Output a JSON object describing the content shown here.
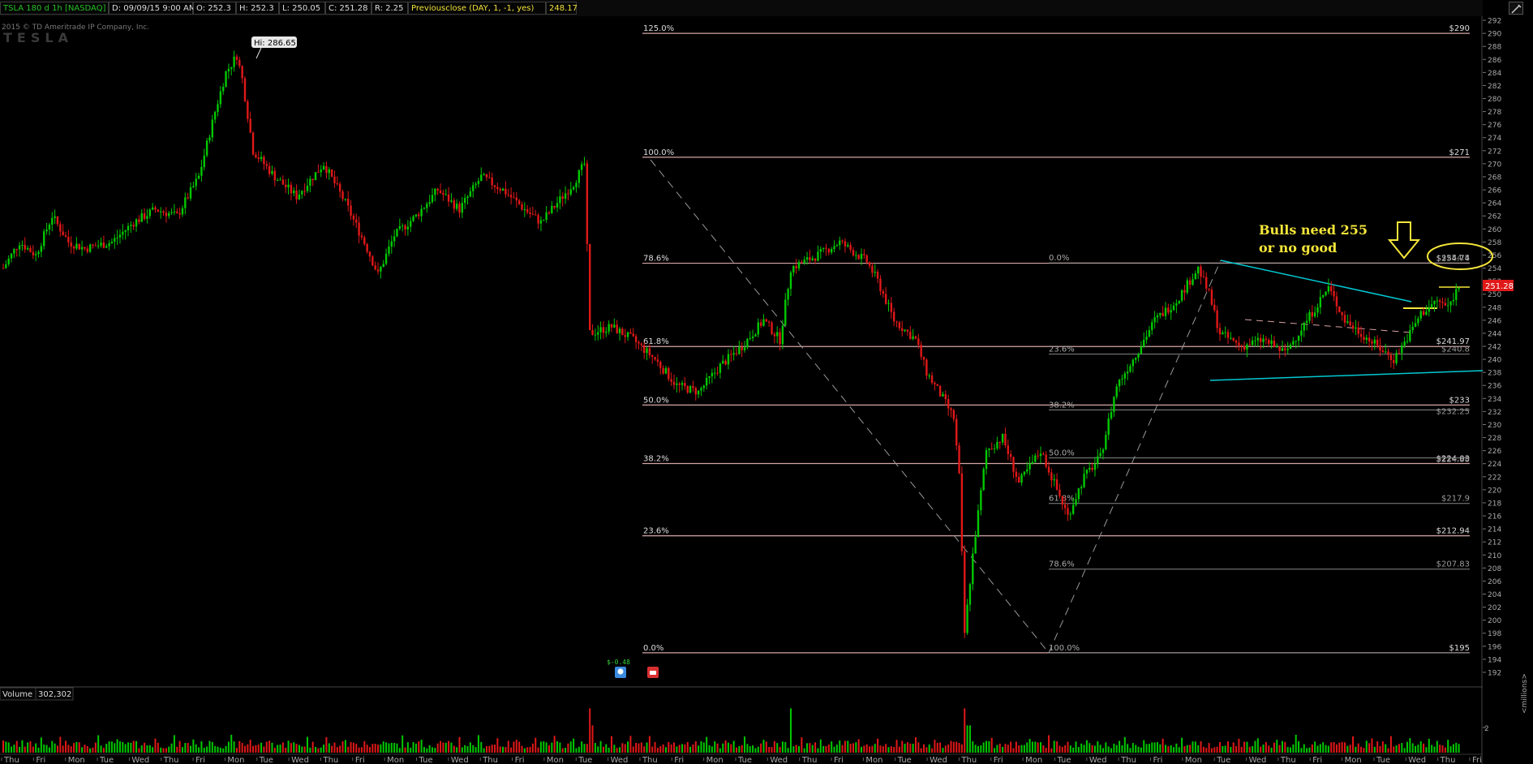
{
  "header": {
    "symbol": "TSLA 180 d 1h [NASDAQ]",
    "date": "D: 09/09/15 9:00 AM",
    "open": "O: 252.3",
    "high": "H: 252.3",
    "low": "L: 250.05",
    "close": "C: 251.28",
    "range": "R: 2.25",
    "study": "Previousclose (DAY, 1, -1, yes)",
    "study_value": "248.17"
  },
  "watermark": {
    "copyright": "2015 © TD Ameritrade IP Company, Inc.",
    "logo": "TESLA"
  },
  "annotation": {
    "text1": "Bulls need 255",
    "text2": "or no good",
    "color": "#f5e63a"
  },
  "price_axis": {
    "ticks": [
      "292",
      "290",
      "288",
      "286",
      "284",
      "282",
      "280",
      "278",
      "276",
      "274",
      "272",
      "270",
      "268",
      "266",
      "264",
      "262",
      "260",
      "258",
      "256",
      "254",
      "252",
      "250",
      "248",
      "246",
      "244",
      "242",
      "240",
      "238",
      "236",
      "234",
      "232",
      "230",
      "228",
      "226",
      "224",
      "222",
      "220",
      "218",
      "216",
      "214",
      "212",
      "210",
      "208",
      "206",
      "204",
      "202",
      "200",
      "198",
      "196",
      "194",
      "192"
    ],
    "current_price": "251.28"
  },
  "volume_panel": {
    "label": "Volume",
    "value": "302,302",
    "axis_tick": "2",
    "unit": "<millions>"
  },
  "events": {
    "dividend_label": "$-0.48"
  },
  "colors": {
    "up": "#00c800",
    "down": "#e01818",
    "background": "#000000",
    "fib": "#d4a5a5",
    "trendline": "#00c8d2"
  },
  "chart_data": {
    "type": "candlestick",
    "symbol": "TSLA",
    "interval": "1h",
    "ylim": [
      191,
      293
    ],
    "hi_label": "Hi: 286.65",
    "x_day_labels": [
      "Thu",
      "Fri",
      "Mon",
      "Tue",
      "Wed",
      "Thu",
      "Fri",
      "Mon",
      "Tue",
      "Wed",
      "Thu",
      "Fri",
      "Mon",
      "Tue",
      "Wed",
      "Thu",
      "Fri",
      "Mon",
      "Tue",
      "Wed",
      "Thu",
      "Fri",
      "Mon",
      "Tue",
      "Wed",
      "Thu",
      "Fri",
      "Mon",
      "Tue",
      "Wed",
      "Thu",
      "Fri",
      "Mon",
      "Tue",
      "Wed",
      "Thu",
      "Fri",
      "Mon",
      "Tue",
      "Wed",
      "Thu",
      "Fri",
      "Mon",
      "Tue",
      "Wed",
      "Thu",
      "Fri"
    ],
    "price_path": [
      [
        0,
        254
      ],
      [
        6,
        258
      ],
      [
        12,
        256
      ],
      [
        18,
        262
      ],
      [
        24,
        258
      ],
      [
        30,
        257
      ],
      [
        40,
        258
      ],
      [
        48,
        261
      ],
      [
        56,
        263
      ],
      [
        64,
        262
      ],
      [
        72,
        268
      ],
      [
        78,
        278
      ],
      [
        82,
        284
      ],
      [
        86,
        286.6
      ],
      [
        88,
        283
      ],
      [
        92,
        272
      ],
      [
        100,
        268
      ],
      [
        108,
        265
      ],
      [
        118,
        270
      ],
      [
        126,
        264
      ],
      [
        134,
        257
      ],
      [
        138,
        253
      ],
      [
        144,
        259
      ],
      [
        152,
        262
      ],
      [
        160,
        266
      ],
      [
        168,
        263
      ],
      [
        176,
        268
      ],
      [
        184,
        266
      ],
      [
        192,
        263
      ],
      [
        198,
        261
      ],
      [
        204,
        264
      ],
      [
        210,
        267
      ],
      [
        214,
        270
      ],
      [
        216,
        244
      ],
      [
        224,
        245
      ],
      [
        232,
        243
      ],
      [
        240,
        240
      ],
      [
        248,
        236
      ],
      [
        256,
        235
      ],
      [
        264,
        239
      ],
      [
        272,
        242
      ],
      [
        280,
        246
      ],
      [
        286,
        243
      ],
      [
        290,
        254
      ],
      [
        300,
        256
      ],
      [
        304,
        257
      ],
      [
        308,
        258
      ],
      [
        318,
        255
      ],
      [
        322,
        252
      ],
      [
        328,
        246
      ],
      [
        336,
        243
      ],
      [
        340,
        238
      ],
      [
        346,
        234
      ],
      [
        350,
        231
      ],
      [
        352,
        222
      ],
      [
        354,
        198
      ],
      [
        357,
        210
      ],
      [
        362,
        226
      ],
      [
        368,
        228
      ],
      [
        374,
        221
      ],
      [
        382,
        226
      ],
      [
        388,
        220
      ],
      [
        392,
        216
      ],
      [
        398,
        222
      ],
      [
        404,
        225
      ],
      [
        410,
        236
      ],
      [
        416,
        240
      ],
      [
        424,
        246
      ],
      [
        432,
        249
      ],
      [
        440,
        254
      ],
      [
        444,
        250
      ],
      [
        448,
        244
      ],
      [
        456,
        242
      ],
      [
        464,
        243
      ],
      [
        472,
        241
      ],
      [
        480,
        246
      ],
      [
        488,
        251
      ],
      [
        494,
        246
      ],
      [
        500,
        244
      ],
      [
        506,
        242
      ],
      [
        512,
        240
      ],
      [
        518,
        244
      ],
      [
        522,
        247
      ],
      [
        528,
        249
      ],
      [
        532,
        248
      ],
      [
        536,
        251.3
      ]
    ],
    "fib_left": {
      "levels": [
        {
          "pct": "125.0%",
          "price": 290,
          "label": "$290"
        },
        {
          "pct": "100.0%",
          "price": 271,
          "label": "$271"
        },
        {
          "pct": "78.6%",
          "price": 254.74,
          "label": "$254.74"
        },
        {
          "pct": "61.8%",
          "price": 241.97,
          "label": "$241.97"
        },
        {
          "pct": "50.0%",
          "price": 233,
          "label": "$233"
        },
        {
          "pct": "38.2%",
          "price": 224.03,
          "label": "$224.03"
        },
        {
          "pct": "23.6%",
          "price": 212.94,
          "label": "$212.94"
        },
        {
          "pct": "0.0%",
          "price": 195,
          "label": "$195"
        }
      ]
    },
    "fib_right": {
      "levels": [
        {
          "pct": "0.0%",
          "price": 254.8,
          "label": "$254.8"
        },
        {
          "pct": "23.6%",
          "price": 240.8,
          "label": "$240.8"
        },
        {
          "pct": "38.2%",
          "price": 232.25,
          "label": "$232.25"
        },
        {
          "pct": "50.0%",
          "price": 224.88,
          "label": "$224.88"
        },
        {
          "pct": "61.8%",
          "price": 217.9,
          "label": "$217.9"
        },
        {
          "pct": "78.6%",
          "price": 207.83,
          "label": "$207.83"
        },
        {
          "pct": "100.0%",
          "price": 195,
          "label": ""
        }
      ]
    }
  }
}
